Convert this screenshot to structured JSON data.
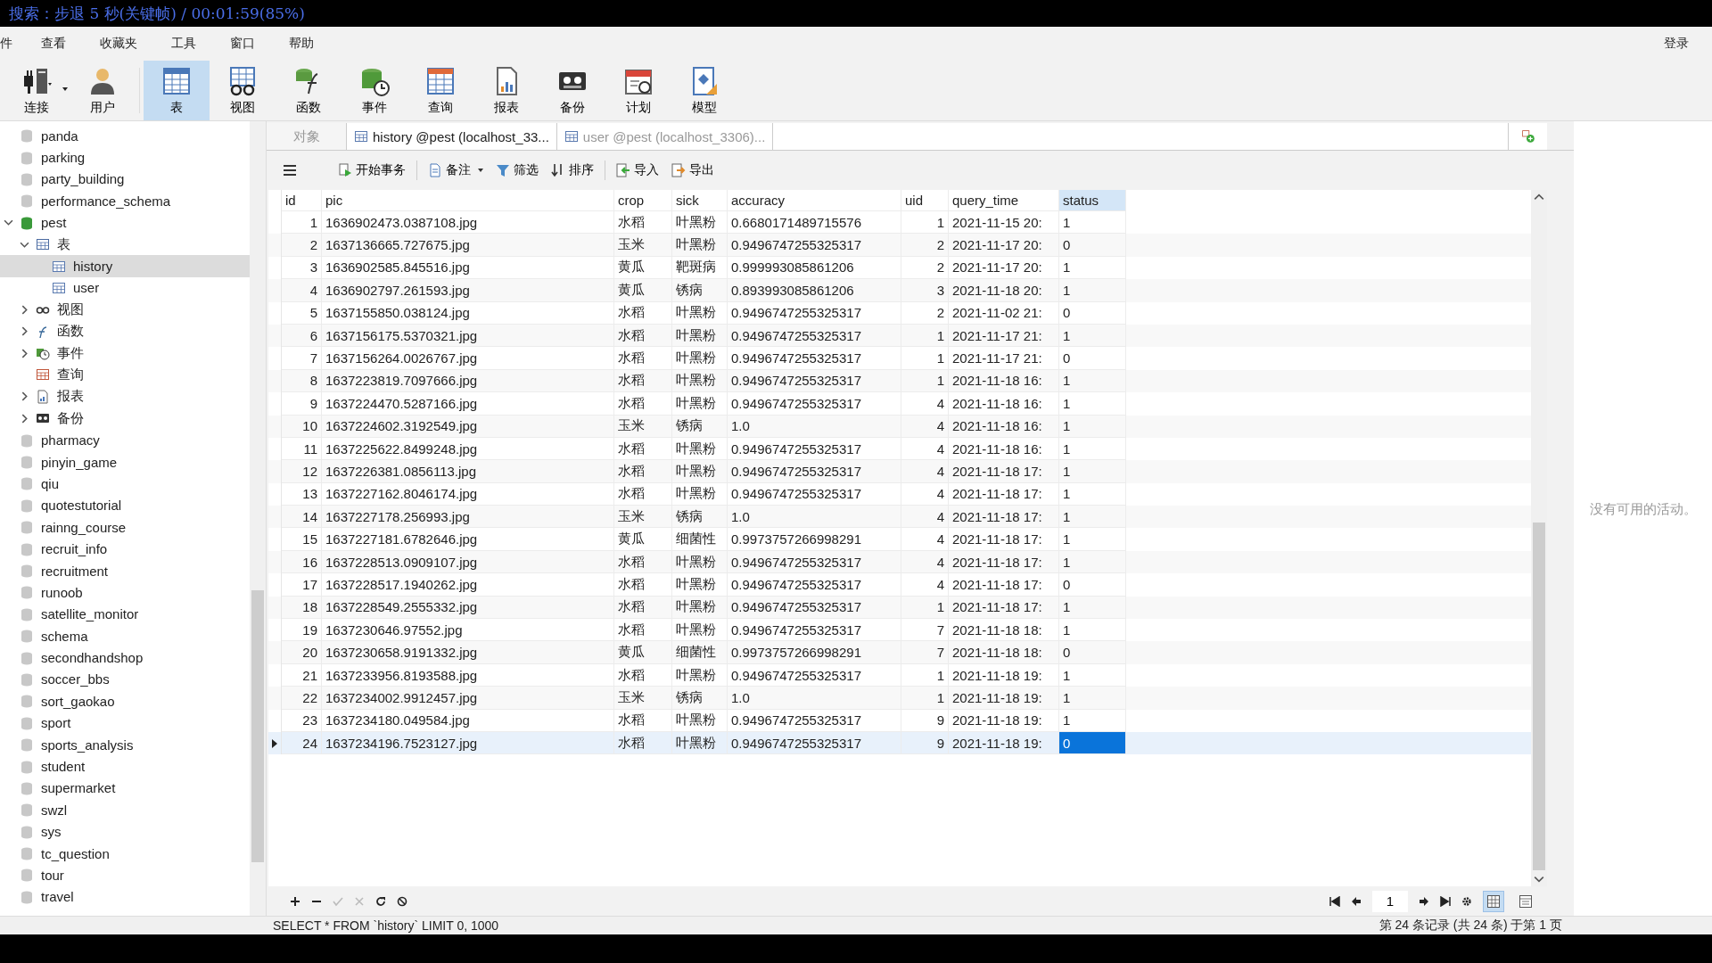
{
  "overlay": {
    "text": "搜索：步退 5 秒(关键帧) / 00:01:59(85%)"
  },
  "menu": [
    "件",
    "查看",
    "收藏夹",
    "工具",
    "窗口",
    "帮助"
  ],
  "login": "登录",
  "toolbar": [
    {
      "label": "连接",
      "kind": "connect",
      "selected": false
    },
    {
      "label": "用户",
      "kind": "user",
      "selected": false
    },
    {
      "label": "表",
      "kind": "table",
      "selected": true
    },
    {
      "label": "视图",
      "kind": "view",
      "selected": false
    },
    {
      "label": "函数",
      "kind": "function",
      "selected": false
    },
    {
      "label": "事件",
      "kind": "event",
      "selected": false
    },
    {
      "label": "查询",
      "kind": "query",
      "selected": false
    },
    {
      "label": "报表",
      "kind": "report",
      "selected": false
    },
    {
      "label": "备份",
      "kind": "backup",
      "selected": false
    },
    {
      "label": "计划",
      "kind": "schedule",
      "selected": false
    },
    {
      "label": "模型",
      "kind": "model",
      "selected": false
    }
  ],
  "sidebar": {
    "items": [
      {
        "label": "panda",
        "kind": "database",
        "selected": false
      },
      {
        "label": "parking",
        "kind": "database",
        "selected": false
      },
      {
        "label": "party_building",
        "kind": "database",
        "selected": false
      },
      {
        "label": "performance_schema",
        "kind": "database",
        "selected": false
      },
      {
        "label": "pest",
        "kind": "database",
        "selected": false,
        "expanded": true,
        "children": [
          {
            "label": "表",
            "kind": "tables",
            "selected": false,
            "expanded": true,
            "children": [
              {
                "label": "history",
                "kind": "table",
                "selected": true
              },
              {
                "label": "user",
                "kind": "table",
                "selected": false
              }
            ]
          },
          {
            "label": "视图",
            "kind": "view",
            "selected": false,
            "expanded": false
          },
          {
            "label": "函数",
            "kind": "function",
            "selected": false,
            "expanded": false
          },
          {
            "label": "事件",
            "kind": "event",
            "selected": false,
            "expanded": false
          },
          {
            "label": "查询",
            "kind": "query",
            "selected": false
          },
          {
            "label": "报表",
            "kind": "report",
            "selected": false,
            "expanded": false
          },
          {
            "label": "备份",
            "kind": "backup",
            "selected": false,
            "expanded": false
          }
        ]
      },
      {
        "label": "pharmacy",
        "kind": "database",
        "selected": false
      },
      {
        "label": "pinyin_game",
        "kind": "database",
        "selected": false
      },
      {
        "label": "qiu",
        "kind": "database",
        "selected": false
      },
      {
        "label": "quotestutorial",
        "kind": "database",
        "selected": false
      },
      {
        "label": "rainng_course",
        "kind": "database",
        "selected": false
      },
      {
        "label": "recruit_info",
        "kind": "database",
        "selected": false
      },
      {
        "label": "recruitment",
        "kind": "database",
        "selected": false
      },
      {
        "label": "runoob",
        "kind": "database",
        "selected": false
      },
      {
        "label": "satellite_monitor",
        "kind": "database",
        "selected": false
      },
      {
        "label": "schema",
        "kind": "database",
        "selected": false
      },
      {
        "label": "secondhandshop",
        "kind": "database",
        "selected": false
      },
      {
        "label": "soccer_bbs",
        "kind": "database",
        "selected": false
      },
      {
        "label": "sort_gaokao",
        "kind": "database",
        "selected": false
      },
      {
        "label": "sport",
        "kind": "database",
        "selected": false
      },
      {
        "label": "sports_analysis",
        "kind": "database",
        "selected": false
      },
      {
        "label": "student",
        "kind": "database",
        "selected": false
      },
      {
        "label": "supermarket",
        "kind": "database",
        "selected": false
      },
      {
        "label": "swzl",
        "kind": "database",
        "selected": false
      },
      {
        "label": "sys",
        "kind": "database",
        "selected": false
      },
      {
        "label": "tc_question",
        "kind": "database",
        "selected": false
      },
      {
        "label": "tour",
        "kind": "database",
        "selected": false
      },
      {
        "label": "travel",
        "kind": "database",
        "selected": false
      }
    ]
  },
  "tabs": [
    {
      "label": "对象",
      "kind": "objects",
      "selected": false
    },
    {
      "label": "history @pest (localhost_33...",
      "kind": "table",
      "selected": true
    },
    {
      "label": "user @pest (localhost_3306)...",
      "kind": "table",
      "selected": false
    }
  ],
  "table_toolbar": [
    {
      "label": "开始事务",
      "kind": "begin"
    },
    {
      "label": "备注",
      "kind": "note"
    },
    {
      "label": "筛选",
      "kind": "filter"
    },
    {
      "label": "排序",
      "kind": "sort"
    },
    {
      "label": "导入",
      "kind": "import"
    },
    {
      "label": "导出",
      "kind": "export"
    }
  ],
  "table": {
    "columns": [
      {
        "label": "id",
        "kind": "number",
        "selected": false
      },
      {
        "label": "pic",
        "kind": "text",
        "selected": false
      },
      {
        "label": "crop",
        "kind": "text",
        "selected": false
      },
      {
        "label": "sick",
        "kind": "text",
        "selected": false
      },
      {
        "label": "accuracy",
        "kind": "text",
        "selected": false
      },
      {
        "label": "uid",
        "kind": "number",
        "selected": false
      },
      {
        "label": "query_time",
        "kind": "text",
        "selected": false
      },
      {
        "label": "status",
        "kind": "text",
        "selected": true
      }
    ],
    "rows": [
      {
        "selected": false,
        "cells": [
          "1",
          "1636902473.0387108.jpg",
          "水稻",
          "叶黑粉",
          "0.6680171489715576",
          "1",
          "2021-11-15 20:",
          "1"
        ]
      },
      {
        "selected": false,
        "cells": [
          "2",
          "1637136665.727675.jpg",
          "玉米",
          "叶黑粉",
          "0.9496747255325317",
          "2",
          "2021-11-17 20:",
          "0"
        ]
      },
      {
        "selected": false,
        "cells": [
          "3",
          "1636902585.845516.jpg",
          "黄瓜",
          "靶斑病",
          "0.999993085861206",
          "2",
          "2021-11-17 20:",
          "1"
        ]
      },
      {
        "selected": false,
        "cells": [
          "4",
          "1636902797.261593.jpg",
          "黄瓜",
          "锈病",
          "0.893993085861206",
          "3",
          "2021-11-18 20:",
          "1"
        ]
      },
      {
        "selected": false,
        "cells": [
          "5",
          "1637155850.038124.jpg",
          "水稻",
          "叶黑粉",
          "0.9496747255325317",
          "2",
          "2021-11-02 21:",
          "0"
        ]
      },
      {
        "selected": false,
        "cells": [
          "6",
          "1637156175.5370321.jpg",
          "水稻",
          "叶黑粉",
          "0.9496747255325317",
          "1",
          "2021-11-17 21:",
          "1"
        ]
      },
      {
        "selected": false,
        "cells": [
          "7",
          "1637156264.0026767.jpg",
          "水稻",
          "叶黑粉",
          "0.9496747255325317",
          "1",
          "2021-11-17 21:",
          "0"
        ]
      },
      {
        "selected": false,
        "cells": [
          "8",
          "1637223819.7097666.jpg",
          "水稻",
          "叶黑粉",
          "0.9496747255325317",
          "1",
          "2021-11-18 16:",
          "1"
        ]
      },
      {
        "selected": false,
        "cells": [
          "9",
          "1637224470.5287166.jpg",
          "水稻",
          "叶黑粉",
          "0.9496747255325317",
          "4",
          "2021-11-18 16:",
          "1"
        ]
      },
      {
        "selected": false,
        "cells": [
          "10",
          "1637224602.3192549.jpg",
          "玉米",
          "锈病",
          "1.0",
          "4",
          "2021-11-18 16:",
          "1"
        ]
      },
      {
        "selected": false,
        "cells": [
          "11",
          "1637225622.8499248.jpg",
          "水稻",
          "叶黑粉",
          "0.9496747255325317",
          "4",
          "2021-11-18 16:",
          "1"
        ]
      },
      {
        "selected": false,
        "cells": [
          "12",
          "1637226381.0856113.jpg",
          "水稻",
          "叶黑粉",
          "0.9496747255325317",
          "4",
          "2021-11-18 17:",
          "1"
        ]
      },
      {
        "selected": false,
        "cells": [
          "13",
          "1637227162.8046174.jpg",
          "水稻",
          "叶黑粉",
          "0.9496747255325317",
          "4",
          "2021-11-18 17:",
          "1"
        ]
      },
      {
        "selected": false,
        "cells": [
          "14",
          "1637227178.256993.jpg",
          "玉米",
          "锈病",
          "1.0",
          "4",
          "2021-11-18 17:",
          "1"
        ]
      },
      {
        "selected": false,
        "cells": [
          "15",
          "1637227181.6782646.jpg",
          "黄瓜",
          "细菌性",
          "0.9973757266998291",
          "4",
          "2021-11-18 17:",
          "1"
        ]
      },
      {
        "selected": false,
        "cells": [
          "16",
          "1637228513.0909107.jpg",
          "水稻",
          "叶黑粉",
          "0.9496747255325317",
          "4",
          "2021-11-18 17:",
          "1"
        ]
      },
      {
        "selected": false,
        "cells": [
          "17",
          "1637228517.1940262.jpg",
          "水稻",
          "叶黑粉",
          "0.9496747255325317",
          "4",
          "2021-11-18 17:",
          "0"
        ]
      },
      {
        "selected": false,
        "cells": [
          "18",
          "1637228549.2555332.jpg",
          "水稻",
          "叶黑粉",
          "0.9496747255325317",
          "1",
          "2021-11-18 17:",
          "1"
        ]
      },
      {
        "selected": false,
        "cells": [
          "19",
          "1637230646.97552.jpg",
          "水稻",
          "叶黑粉",
          "0.9496747255325317",
          "7",
          "2021-11-18 18:",
          "1"
        ]
      },
      {
        "selected": false,
        "cells": [
          "20",
          "1637230658.9191332.jpg",
          "黄瓜",
          "细菌性",
          "0.9973757266998291",
          "7",
          "2021-11-18 18:",
          "0"
        ]
      },
      {
        "selected": false,
        "cells": [
          "21",
          "1637233956.8193588.jpg",
          "水稻",
          "叶黑粉",
          "0.9496747255325317",
          "1",
          "2021-11-18 19:",
          "1"
        ]
      },
      {
        "selected": false,
        "cells": [
          "22",
          "1637234002.9912457.jpg",
          "玉米",
          "锈病",
          "1.0",
          "1",
          "2021-11-18 19:",
          "1"
        ]
      },
      {
        "selected": false,
        "cells": [
          "23",
          "1637234180.049584.jpg",
          "水稻",
          "叶黑粉",
          "0.9496747255325317",
          "9",
          "2021-11-18 19:",
          "1"
        ]
      },
      {
        "selected": true,
        "cells": [
          "24",
          "1637234196.7523127.jpg",
          "水稻",
          "叶黑粉",
          "0.9496747255325317",
          "9",
          "2021-11-18 19:",
          "0"
        ]
      }
    ]
  },
  "pager": {
    "page": "1"
  },
  "status_bar": {
    "sql": "SELECT * FROM `history` LIMIT 0, 1000",
    "records": "第 24 条记录 (共 24 条) 于第 1 页"
  },
  "activity_panel": {
    "message": "没有可用的活动。"
  }
}
